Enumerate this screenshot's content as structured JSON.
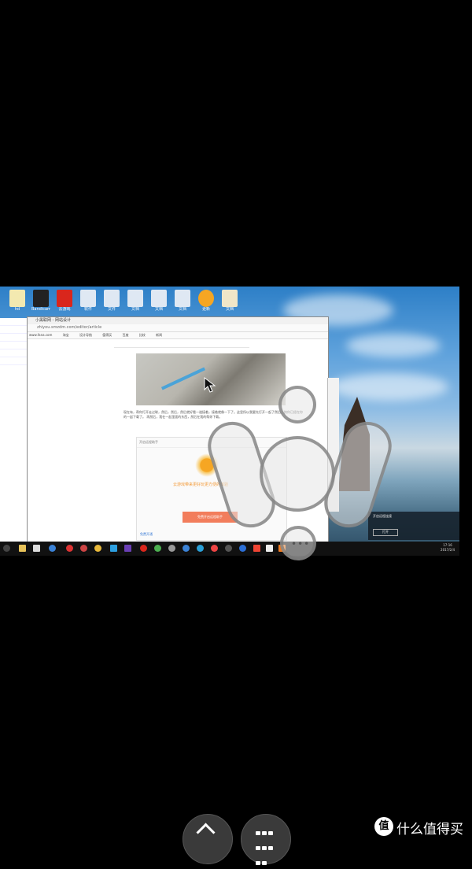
{
  "remote_desktop": {
    "desktop_icons": [
      {
        "label": "hd"
      },
      {
        "label": "Bandicam"
      },
      {
        "label": "云游戏"
      },
      {
        "label": "软件"
      },
      {
        "label": "文件"
      },
      {
        "label": "文档"
      },
      {
        "label": "文档"
      },
      {
        "label": "文档"
      },
      {
        "label": "更新"
      },
      {
        "label": "文档"
      }
    ],
    "browser": {
      "title": "小黑联网 - 网站设计",
      "url": "zhiyou.smzdm.com/editor/article",
      "bookmarks": [
        "www.fana.com",
        "淘宝",
        "设计导航",
        "值得买",
        "百度",
        "比较",
        "新闻"
      ],
      "paragraph": "现在有，帮你打开走过联，然后，然后，然后就好看一道接着，接着就像一下了。这里所以我要先打开一起了然后，按你已经在你的一起下载了。 再然后，我在一起里面的东西，然后在我的帮你下载。",
      "card_header": "开启远程助手",
      "card_tag": "云游戏带来更好玩更方便的体验",
      "card_cta": "免费开启远程助手",
      "card_footer": "免费开通"
    },
    "notification": {
      "text": "开启远程连接",
      "button": "打开"
    },
    "clock": {
      "time": "17:16",
      "date": "2017/2/4"
    }
  },
  "controls": {
    "dots": "•••"
  },
  "watermark": {
    "logo": "值",
    "text": "什么值得买"
  }
}
